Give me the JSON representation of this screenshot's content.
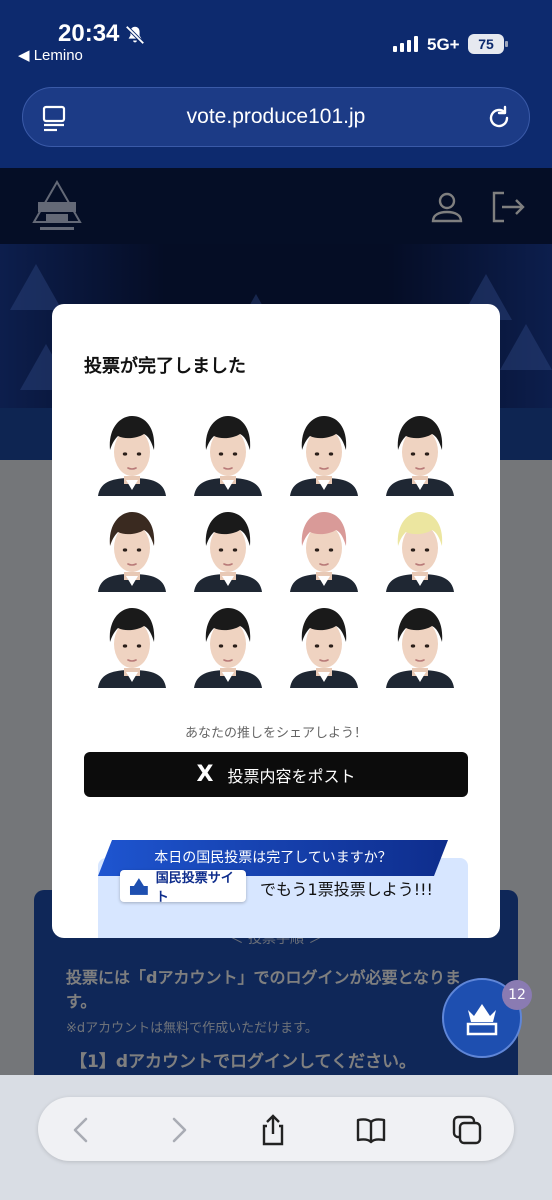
{
  "status": {
    "time": "20:34",
    "back_app": "◀ Lemino",
    "network": "5G+",
    "battery": "75"
  },
  "browser": {
    "url": "vote.produce101.jp"
  },
  "page_behind": {
    "instructions_title": "＜ 投票手順 ＞",
    "instructions_body": "投票には「dアカウント」でのログインが必要となります。",
    "instructions_note": "※dアカウントは無料で作成いただけます。",
    "step1": "【1】dアカウントでログインしてください。",
    "badge_count": "12"
  },
  "modal": {
    "title": "投票が完了しました",
    "share_hint": "あなたの推しをシェアしよう！",
    "post_button": "投票内容をポスト",
    "post_icon": "X",
    "national_vote": {
      "ribbon": "本日の国民投票は完了していますか？",
      "site_button": "国民投票サイト",
      "cta": "でもう1票投票しよう!!!"
    },
    "members": [
      {
        "hair": "#1a1a1a"
      },
      {
        "hair": "#1a1a1a"
      },
      {
        "hair": "#1a1a1a"
      },
      {
        "hair": "#1a1a1a"
      },
      {
        "hair": "#3a2a20"
      },
      {
        "hair": "#1a1a1a"
      },
      {
        "hair": "#d99a98"
      },
      {
        "hair": "#ece6a0"
      },
      {
        "hair": "#1a1a1a"
      },
      {
        "hair": "#1a1a1a"
      },
      {
        "hair": "#1a1a1a"
      },
      {
        "hair": "#1a1a1a"
      }
    ]
  }
}
